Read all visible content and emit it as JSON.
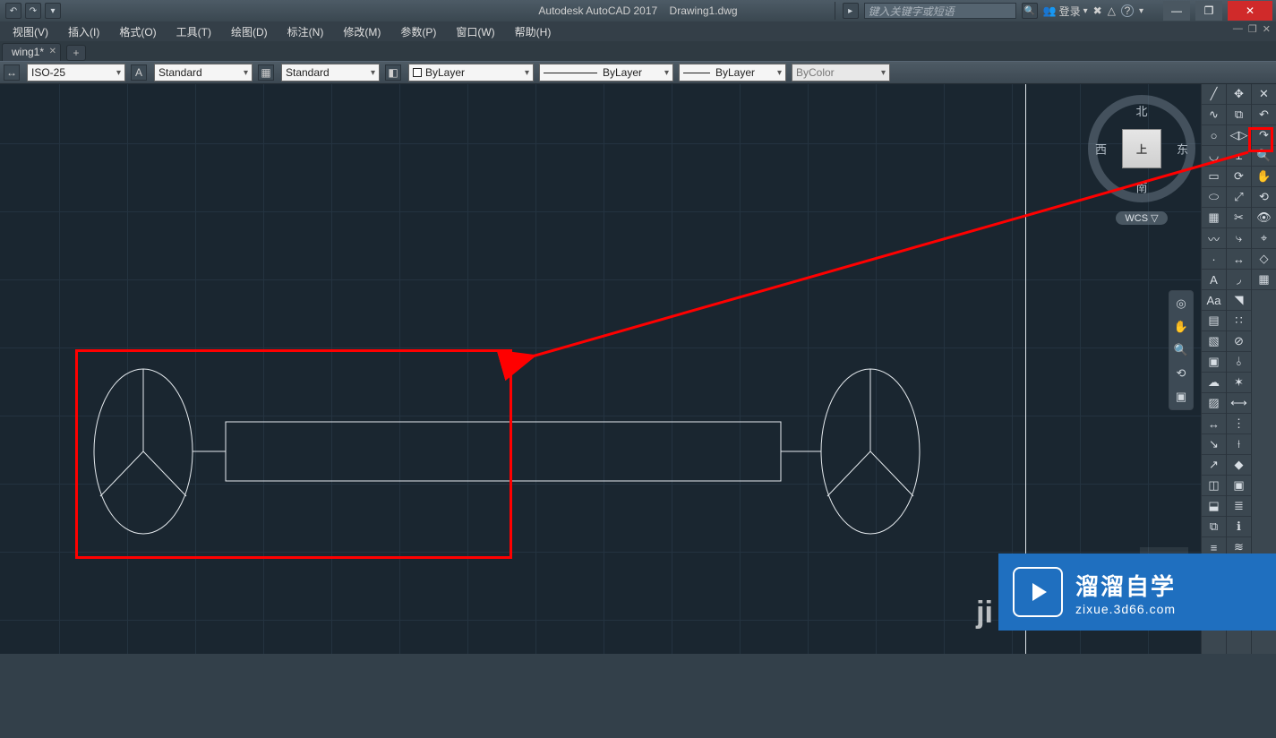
{
  "title": {
    "app": "Autodesk AutoCAD 2017",
    "file": "Drawing1.dwg"
  },
  "search": {
    "placeholder": "键入关键字或短语"
  },
  "account": {
    "login": "登录"
  },
  "menubar": {
    "items": [
      "视图(V)",
      "插入(I)",
      "格式(O)",
      "工具(T)",
      "绘图(D)",
      "标注(N)",
      "修改(M)",
      "参数(P)",
      "窗口(W)",
      "帮助(H)"
    ]
  },
  "tabs": {
    "active": "wing1*"
  },
  "toolbar": {
    "dimstyle": "ISO-25",
    "textstyle1": "Standard",
    "textstyle2": "Standard",
    "layer": "ByLayer",
    "linetype": "ByLayer",
    "lineweight": "ByLayer",
    "color": "ByColor"
  },
  "viewcube": {
    "north": "北",
    "south": "南",
    "west": "西",
    "east": "东",
    "face": "上",
    "wcs": "WCS ▽"
  },
  "watermark": {
    "cn": "溜溜自学",
    "en": "zixue.3d66.com",
    "bg_left": "ji",
    "bg_right": "E"
  },
  "tool_icons_col1": [
    "line",
    "pline",
    "circle",
    "arc",
    "rect",
    "ellipse",
    "hatch",
    "spline",
    "point",
    "text",
    "mtext",
    "table",
    "region",
    "bound",
    "cloud",
    "wipe",
    "dim",
    "lead",
    "mlead",
    "block",
    "ins",
    "xref",
    "align",
    "dist",
    "area",
    "a"
  ],
  "tool_icons_col2": [
    "move",
    "copy",
    "mirror",
    "offset",
    "rotate",
    "scale",
    "trim",
    "extend",
    "stretch",
    "fillet",
    "chamfer",
    "array",
    "break",
    "join",
    "explode",
    "lengthen",
    "divide",
    "measure",
    "grip",
    "group",
    "layer",
    "props",
    "match",
    "ed",
    "er"
  ],
  "tool_icons_col3": [
    "erase",
    "undo",
    "redo",
    "zoom",
    "pan",
    "orbit",
    "view",
    "ucs",
    "snap",
    "grid"
  ]
}
